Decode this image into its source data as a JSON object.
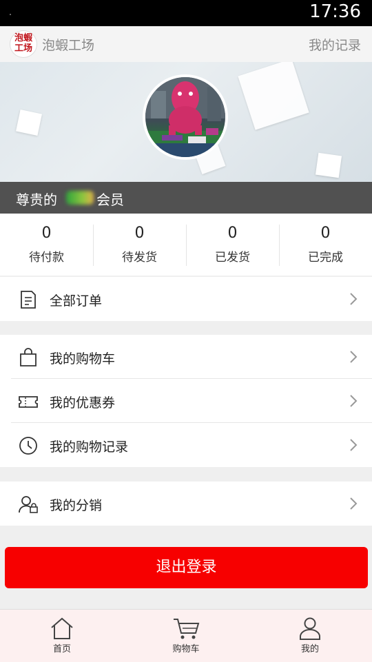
{
  "statusbar": {
    "time": "17:36"
  },
  "header": {
    "logo_text_line1": "泡蝦",
    "logo_text_line2": "工场",
    "app_name": "泡蝦工场",
    "records_link": "我的记录"
  },
  "profile": {
    "member_prefix": "尊贵的",
    "member_suffix": "会员"
  },
  "order_counts": [
    {
      "count": "0",
      "label": "待付款"
    },
    {
      "count": "0",
      "label": "待发货"
    },
    {
      "count": "0",
      "label": "已发货"
    },
    {
      "count": "0",
      "label": "已完成"
    }
  ],
  "menu": {
    "all_orders": "全部订单",
    "cart": "我的购物车",
    "coupons": "我的优惠券",
    "history": "我的购物记录",
    "distribution": "我的分销"
  },
  "logout": "退出登录",
  "tabs": [
    {
      "label": "首页",
      "icon": "home-icon"
    },
    {
      "label": "购物车",
      "icon": "cart-icon"
    },
    {
      "label": "我的",
      "icon": "user-icon"
    }
  ],
  "colors": {
    "accent_red": "#f70000",
    "member_bar": "#515151",
    "tabbar_bg": "#fdf0f0"
  }
}
